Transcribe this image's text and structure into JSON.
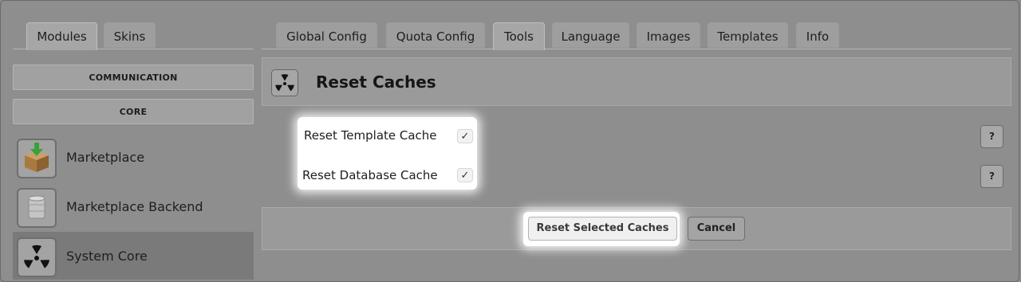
{
  "left_tabs": [
    {
      "label": "Modules",
      "active": true
    },
    {
      "label": "Skins",
      "active": false
    }
  ],
  "top_tabs": [
    {
      "label": "Global Config",
      "active": false
    },
    {
      "label": "Quota Config",
      "active": false
    },
    {
      "label": "Tools",
      "active": true
    },
    {
      "label": "Language",
      "active": false
    },
    {
      "label": "Images",
      "active": false
    },
    {
      "label": "Templates",
      "active": false
    },
    {
      "label": "Info",
      "active": false
    }
  ],
  "sidebar": {
    "categories": [
      "COMMUNICATION",
      "CORE"
    ],
    "modules": [
      {
        "label": "Marketplace",
        "icon": "package-download-icon",
        "active": false
      },
      {
        "label": "Marketplace Backend",
        "icon": "database-icon",
        "active": false
      },
      {
        "label": "System Core",
        "icon": "radiation-icon",
        "active": true
      }
    ]
  },
  "panel": {
    "title": "Reset Caches",
    "icon": "radiation-icon",
    "options": [
      {
        "label": "Reset Template Cache",
        "checked": true,
        "help": "?"
      },
      {
        "label": "Reset Database Cache",
        "checked": true,
        "help": "?"
      }
    ],
    "primary_button": "Reset Selected Caches",
    "cancel_button": "Cancel"
  },
  "colors": {
    "background": "#8e8e8e",
    "highlight": "#ffffff",
    "active_module": "#7a7a7a"
  }
}
